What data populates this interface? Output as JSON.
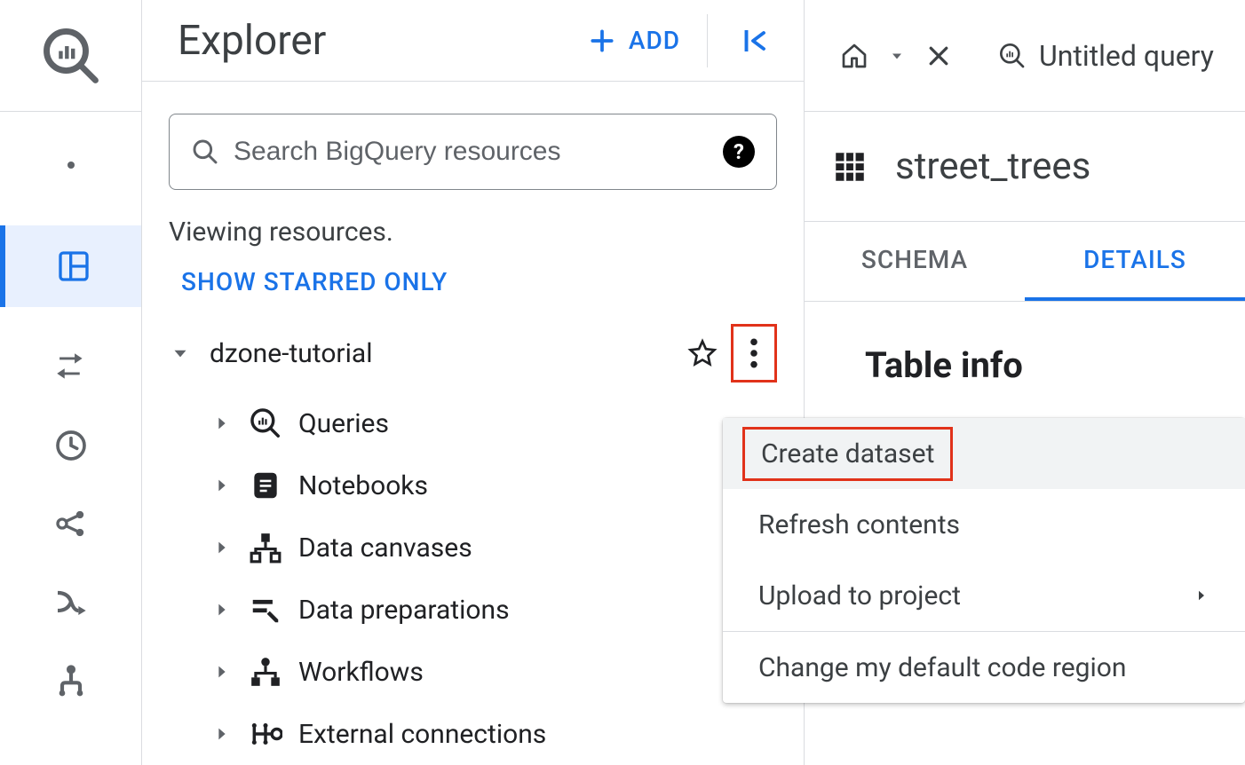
{
  "explorer": {
    "title": "Explorer",
    "add_label": "ADD",
    "search_placeholder": "Search BigQuery resources",
    "viewing_text": "Viewing resources.",
    "starred_label": "SHOW STARRED ONLY",
    "project_name": "dzone-tutorial",
    "children": [
      {
        "label": "Queries"
      },
      {
        "label": "Notebooks"
      },
      {
        "label": "Data canvases"
      },
      {
        "label": "Data preparations"
      },
      {
        "label": "Workflows"
      },
      {
        "label": "External connections"
      }
    ]
  },
  "right": {
    "untitled_query": "Untitled query",
    "table_name": "street_trees",
    "tabs": {
      "schema": "SCHEMA",
      "details": "DETAILS"
    },
    "table_info_heading": "Table info"
  },
  "context_menu": {
    "create_dataset": "Create dataset",
    "refresh": "Refresh contents",
    "upload": "Upload to project",
    "change_region": "Change my default code region"
  }
}
